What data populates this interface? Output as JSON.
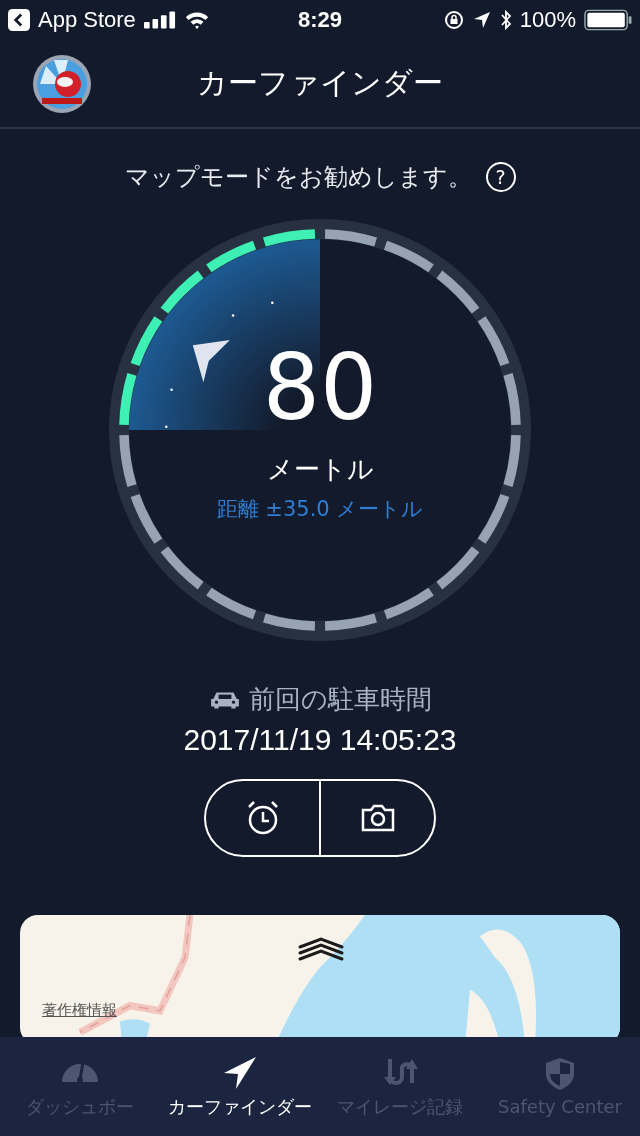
{
  "status_bar": {
    "back_label": "App Store",
    "time": "8:29",
    "battery": "100%"
  },
  "header": {
    "title": "カーファインダー"
  },
  "hint": {
    "text": "マップモードをお勧めします。",
    "help": "?"
  },
  "gauge": {
    "value": "80",
    "unit": "メートル",
    "accuracy": "距離 ±35.0 メートル",
    "level": 0.25
  },
  "parking": {
    "label": "前回の駐車時間",
    "time": "2017/11/19 14:05:23"
  },
  "map": {
    "copyright": "著作権情報"
  },
  "tabs": [
    {
      "label": "ダッシュボー",
      "selected": false
    },
    {
      "label": "カーファインダー",
      "selected": true
    },
    {
      "label": "マイレージ記録",
      "selected": false
    },
    {
      "label": "Safety Center",
      "selected": false
    }
  ]
}
